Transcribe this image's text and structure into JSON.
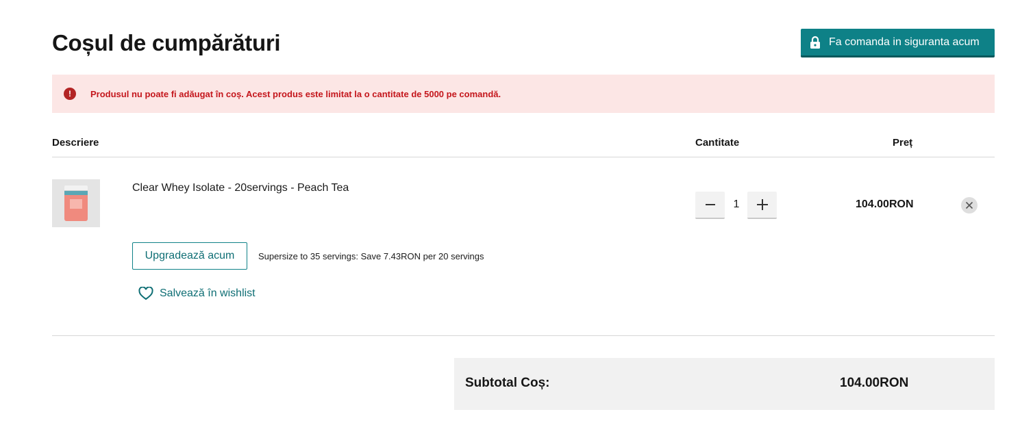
{
  "page": {
    "title": "Coșul de cumpărături"
  },
  "checkout": {
    "label": "Fa comanda in siguranta acum"
  },
  "alert": {
    "message": "Produsul nu poate fi adăugat în coș. Acest produs este limitat la o cantitate de 5000 pe comandă."
  },
  "table": {
    "headers": {
      "description": "Descriere",
      "quantity": "Cantitate",
      "price": "Preț"
    }
  },
  "item": {
    "name": "Clear Whey Isolate - 20servings - Peach Tea",
    "quantity": "1",
    "price": "104.00RON",
    "upgrade_label": "Upgradează acum",
    "upsell_text": "Supersize to 35 servings: Save 7.43RON per 20 servings",
    "wishlist_label": "Salvează în wishlist"
  },
  "subtotal": {
    "label": "Subtotal Coș:",
    "value": "104.00RON"
  },
  "colors": {
    "accent": "#0e8187",
    "alert_bg": "#fce6e5",
    "alert_text": "#c4161c",
    "subtotal_bg": "#f1f1f1"
  },
  "icons": {
    "checkout": "lock-icon",
    "alert": "error-icon",
    "minus": "minus-icon",
    "plus": "plus-icon",
    "remove": "close-icon",
    "wishlist": "heart-icon"
  }
}
